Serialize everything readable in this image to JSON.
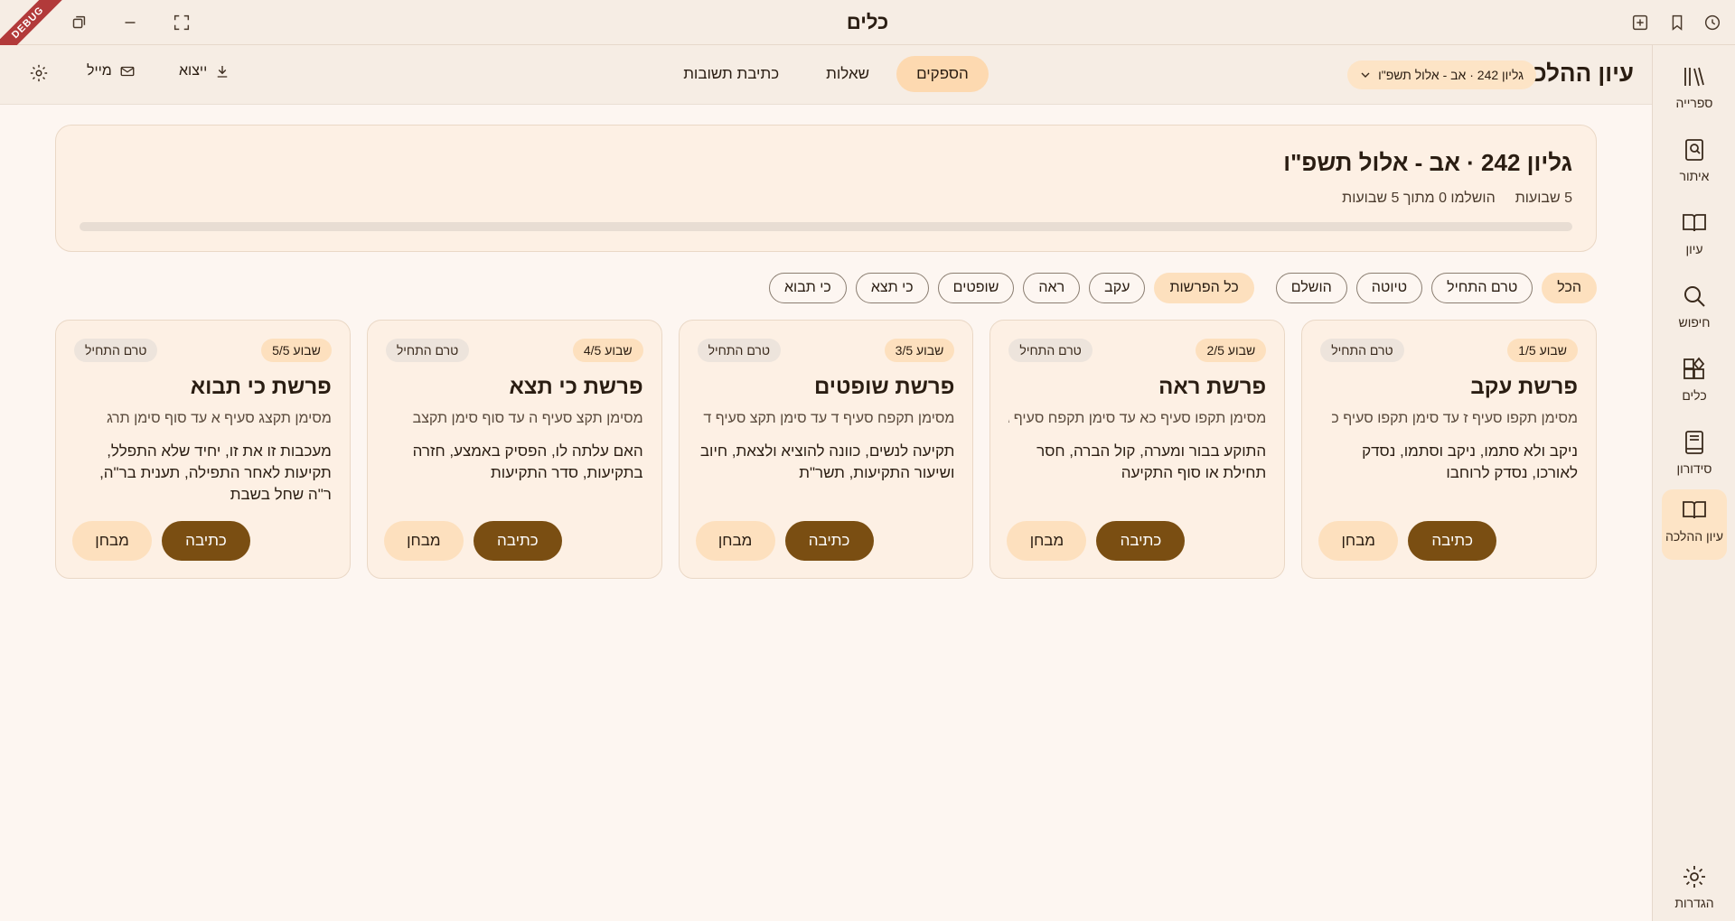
{
  "window": {
    "title": "כלים",
    "debug_label": "DEBUG"
  },
  "sidebar": {
    "items": [
      {
        "label": "ספרייה",
        "icon": "library-icon"
      },
      {
        "label": "איתור",
        "icon": "locate-book-icon"
      },
      {
        "label": "עיון",
        "icon": "open-book-icon"
      },
      {
        "label": "חיפוש",
        "icon": "search-icon"
      },
      {
        "label": "כלים",
        "icon": "tools-grid-icon"
      },
      {
        "label": "סידורון",
        "icon": "prayer-book-icon"
      },
      {
        "label": "עיון ההלכה",
        "icon": "open-book-icon"
      }
    ],
    "settings_label": "הגדרות"
  },
  "toolbar": {
    "app_title": "עיון ההלכה",
    "issue_selected": "גליון 242 · אב - אלול תשפ\"ו",
    "tabs": [
      "הספקים",
      "שאלות",
      "כתיבת תשובות"
    ],
    "export_label": "ייצוא",
    "mail_label": "מייל"
  },
  "summary": {
    "title": "גליון 242 · אב - אלול תשפ\"ו",
    "weeks": "5 שבועות",
    "completed": "הושלמו 0 מתוך 5 שבועות",
    "progress": 0
  },
  "filters": {
    "status": [
      "הכל",
      "טרם התחיל",
      "טיוטה",
      "הושלם"
    ],
    "parashot": [
      "כל הפרשות",
      "עקב",
      "ראה",
      "שופטים",
      "כי תצא",
      "כי תבוא"
    ]
  },
  "cards": [
    {
      "week": "שבוע 1/5",
      "status": "טרם התחיל",
      "title": "פרשת עקב",
      "range": "מסימן תקפו סעיף ז עד סימן תקפו סעיף כ",
      "desc": "ניקב ולא סתמו, ניקב וסתמו, נסדק לאורכו, נסדק לרוחבו",
      "test": "מבחן",
      "write": "כתיבה"
    },
    {
      "week": "שבוע 2/5",
      "status": "טרם התחיל",
      "title": "פרשת ראה",
      "range": "מסימן תקפו סעיף כא עד סימן תקפח סעיף ג",
      "desc": "התוקע בבור ומערה, קול הברה, חסר תחילת או סוף התקיעה",
      "test": "מבחן",
      "write": "כתיבה"
    },
    {
      "week": "שבוע 3/5",
      "status": "טרם התחיל",
      "title": "פרשת שופטים",
      "range": "מסימן תקפח סעיף ד עד סימן תקצ סעיף ד",
      "desc": "תקיעה לנשים, כוונה להוציא ולצאת, חיוב ושיעור התקיעות, תשר\"ת",
      "test": "מבחן",
      "write": "כתיבה"
    },
    {
      "week": "שבוע 4/5",
      "status": "טרם התחיל",
      "title": "פרשת כי תצא",
      "range": "מסימן תקצ סעיף ה עד סוף סימן תקצב",
      "desc": "האם עלתה לו, הפסיק באמצע, חזרה בתקיעות, סדר התקיעות",
      "test": "מבחן",
      "write": "כתיבה"
    },
    {
      "week": "שבוע 5/5",
      "status": "טרם התחיל",
      "title": "פרשת כי תבוא",
      "range": "מסימן תקצג סעיף א עד סוף סימן תרג",
      "desc": "מעכבות זו את זו, יחיד שלא התפלל, תקיעות לאחר התפילה, תענית בר\"ה, ר\"ה שחל בשבת",
      "test": "מבחן",
      "write": "כתיבה"
    }
  ],
  "colors": {
    "accent": "#7a4e12",
    "chip_active": "#fde0be",
    "background": "#fdf6f1"
  }
}
